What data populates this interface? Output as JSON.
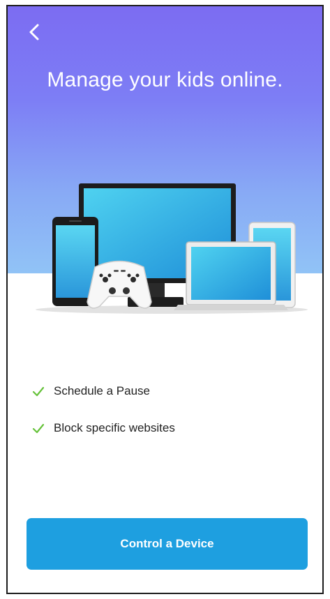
{
  "header": {
    "back_icon": "chevron-left-icon",
    "title": "Manage your kids online."
  },
  "illustration": {
    "items": [
      "smartphone",
      "monitor",
      "game-controller",
      "laptop",
      "tablet"
    ]
  },
  "features": [
    {
      "icon": "check-icon",
      "label": "Schedule a Pause"
    },
    {
      "icon": "check-icon",
      "label": "Block specific websites"
    }
  ],
  "cta": {
    "label": "Control a Device"
  },
  "colors": {
    "gradient_top": "#7c6cf2",
    "gradient_bottom": "#91c3f6",
    "check": "#66c23a",
    "button": "#1e9fe0",
    "button_text": "#ffffff",
    "title_text": "#ffffff"
  }
}
